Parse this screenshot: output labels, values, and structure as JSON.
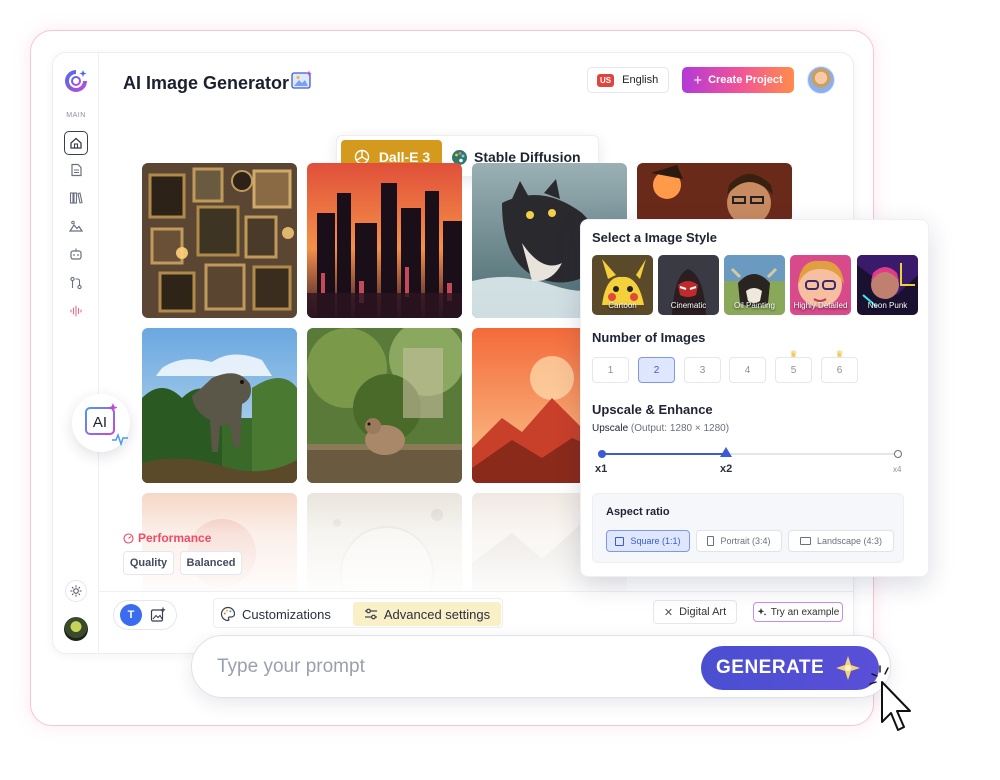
{
  "header": {
    "title": "AI Image Generator",
    "language": {
      "code": "US",
      "label": "English"
    },
    "create_button": "Create Project"
  },
  "sidebar": {
    "section_label": "MAIN",
    "items": [
      {
        "name": "home",
        "active": true
      },
      {
        "name": "document"
      },
      {
        "name": "library"
      },
      {
        "name": "image"
      },
      {
        "name": "bot"
      },
      {
        "name": "flow"
      },
      {
        "name": "audio"
      }
    ]
  },
  "models": {
    "options": [
      "Dall-E 3",
      "Stable Diffusion"
    ],
    "selected": "Dall-E 3"
  },
  "performance": {
    "label": "Performance",
    "options": [
      "Quality",
      "Balanced"
    ]
  },
  "toolbar": {
    "tabs": [
      "Customizations",
      "Advanced settings"
    ],
    "active_tab": "Advanced settings",
    "style_chip": "Digital Art",
    "try_example": "Try an example"
  },
  "prompt": {
    "placeholder": "Type your prompt",
    "generate_label": "GENERATE"
  },
  "style_panel": {
    "style_title": "Select a Image Style",
    "styles": [
      "Cartoon",
      "Cinematic",
      "Oil Painting",
      "Highly Detailed",
      "Neon Punk"
    ],
    "number_title": "Number of Images",
    "numbers": [
      "1",
      "2",
      "3",
      "4",
      "5",
      "6"
    ],
    "numbers_selected": "2",
    "numbers_premium": [
      "5",
      "6"
    ],
    "upscale_title": "Upscale & Enhance",
    "upscale_label": "Upscale",
    "upscale_output": "(Output: 1280 × 1280)",
    "upscale_steps": [
      "x1",
      "x2",
      "x4"
    ],
    "upscale_selected": "x2",
    "aspect_title": "Aspect ratio",
    "aspect_options": [
      "Square (1:1)",
      "Portrait (3:4)",
      "Landscape (4:3)"
    ],
    "aspect_selected": "Square (1:1)"
  },
  "ai_badge": "AI",
  "colors": {
    "accent": "#3a5ad8",
    "dalle": "#d39a1e",
    "generate": "#4a4fd0",
    "performance": "#f04a64",
    "create_gradient": [
      "#b23ad8",
      "#f0529a",
      "#ff8c4a"
    ]
  }
}
